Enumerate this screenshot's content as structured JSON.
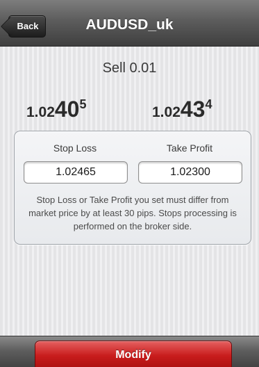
{
  "navbar": {
    "back_label": "Back",
    "title": "AUDUSD_uk"
  },
  "order": {
    "title": "Sell 0.01"
  },
  "quotes": {
    "bid": {
      "prefix": "1.02",
      "big": "40",
      "sup": "5"
    },
    "ask": {
      "prefix": "1.02",
      "big": "43",
      "sup": "4"
    }
  },
  "sltp": {
    "stop_loss_label": "Stop Loss",
    "take_profit_label": "Take Profit",
    "stop_loss_value": "1.02465",
    "take_profit_value": "1.02300",
    "note": "Stop Loss or Take Profit you set must differ from market price by at least 30 pips. Stops processing is performed on the broker side."
  },
  "toolbar": {
    "modify_label": "Modify"
  }
}
